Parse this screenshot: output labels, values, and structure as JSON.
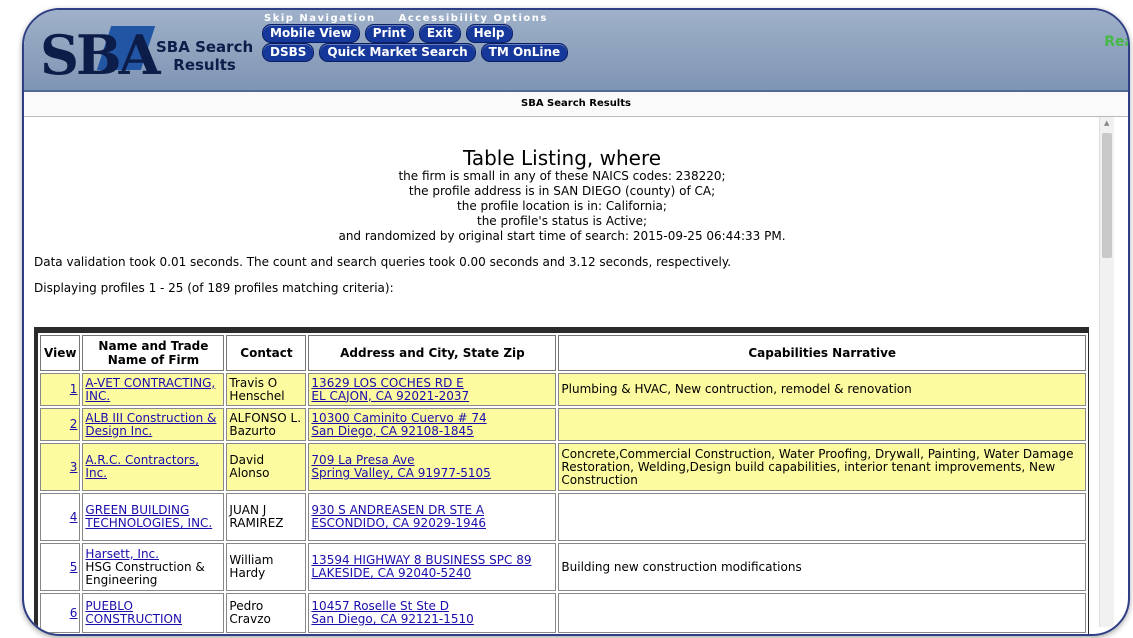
{
  "header": {
    "logo_text": "SBA",
    "title_line1": "SBA Search",
    "title_line2": "Results",
    "skip_links": [
      "Skip Navigation",
      "Accessibility Options"
    ],
    "buttons_row1": [
      "Mobile View",
      "Print",
      "Exit",
      "Help"
    ],
    "buttons_row2": [
      "DSBS",
      "Quick Market Search",
      "TM OnLine"
    ],
    "status_text": "Rea"
  },
  "subtitle": "SBA Search Results",
  "listing": {
    "heading": "Table Listing, where",
    "criteria": [
      "the firm is small in any of these NAICS codes: 238220;",
      "the profile address is in SAN DIEGO (county) of CA;",
      "the profile location is in: California;",
      "the profile's status is Active;",
      "and randomized by original start time of search: 2015-09-25 06:44:33 PM."
    ],
    "validation_text": "Data validation took 0.01 seconds. The count and search queries took 0.00 seconds and 3.12 seconds, respectively.",
    "displaying_text": "Displaying profiles 1 - 25 (of 189 profiles matching criteria):"
  },
  "table": {
    "headers": [
      "View",
      "Name and Trade Name of Firm",
      "Contact",
      "Address and City, State Zip",
      "Capabilities Narrative"
    ],
    "rows": [
      {
        "view": "1",
        "name": "A-VET CONTRACTING, INC.",
        "trade": "",
        "contact": "Travis O Henschel",
        "addr1": "13629 LOS COCHES RD E",
        "addr2": "EL CAJON, CA 92021-2037",
        "narrative": "Plumbing & HVAC, New contruction, remodel & renovation"
      },
      {
        "view": "2",
        "name": "ALB III Construction & Design Inc.",
        "trade": "",
        "contact": "ALFONSO L. Bazurto",
        "addr1": "10300 Caminito Cuervo # 74",
        "addr2": "San Diego, CA 92108-1845",
        "narrative": ""
      },
      {
        "view": "3",
        "name": "A.R.C. Contractors, Inc.",
        "trade": "",
        "contact": "David Alonso",
        "addr1": "709 La Presa Ave",
        "addr2": "Spring Valley, CA 91977-5105",
        "narrative": "Concrete,Commercial Construction, Water Proofing, Drywall, Painting, Water Damage Restoration, Welding,Design build capabilities, interior tenant improvements, New Construction"
      },
      {
        "view": "4",
        "name": "GREEN BUILDING TECHNOLOGIES, INC.",
        "trade": "",
        "contact": "JUAN J RAMIREZ",
        "addr1": "930 S ANDREASEN DR STE A",
        "addr2": "ESCONDIDO, CA 92029-1946",
        "narrative": ""
      },
      {
        "view": "5",
        "name": "Harsett, Inc.",
        "trade": "HSG Construction & Engineering",
        "contact": "William Hardy",
        "addr1": "13594 HIGHWAY 8 BUSINESS SPC 89",
        "addr2": "LAKESIDE, CA 92040-5240",
        "narrative": "Building new construction modifications"
      },
      {
        "view": "6",
        "name": "PUEBLO CONSTRUCTION",
        "trade": "",
        "contact": "Pedro Cravzo",
        "addr1": "10457 Roselle St Ste D",
        "addr2": "San Diego, CA 92121-1510",
        "narrative": ""
      }
    ]
  },
  "colors": {
    "highlight_row": "#fdfb9f",
    "banner": "#8fa3bf",
    "link": "#1a0dab",
    "pill": "#15389a",
    "ready": "#45b845"
  }
}
